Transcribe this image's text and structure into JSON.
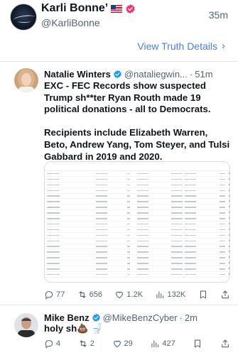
{
  "post": {
    "display_name": "Karli Bonne’",
    "handle": "@KarliBonne",
    "time": "35m",
    "view_details": "View Truth Details",
    "chevron": "›"
  },
  "quoted_tweet": {
    "name": "Natalie Winters",
    "handle": "@nataliegwin...",
    "separator": "·",
    "time": "51m",
    "text_1": "EXC - FEC Records show suspected Trump sh**ter Ryan Routh made 19 political donations - all to Democrats.",
    "text_2": "Recipients include Elizabeth Warren, Beto, Andrew Yang, Tom Steyer, and Tulsi Gabbard in 2019 and 2020.",
    "actions": {
      "replies": "77",
      "retweets": "656",
      "likes": "1.2K",
      "views": "132K"
    }
  },
  "reply_tweet": {
    "name": "Mike Benz",
    "handle": "@MikeBenzCyber",
    "separator": "·",
    "time": "2m",
    "text": "holy sh💩 🚽",
    "actions": {
      "replies": "4",
      "retweets": "2",
      "likes": "29",
      "views": "427"
    }
  },
  "colors": {
    "link": "#4a7fd8",
    "verified": "#1d9bf0",
    "muted": "#536471"
  }
}
